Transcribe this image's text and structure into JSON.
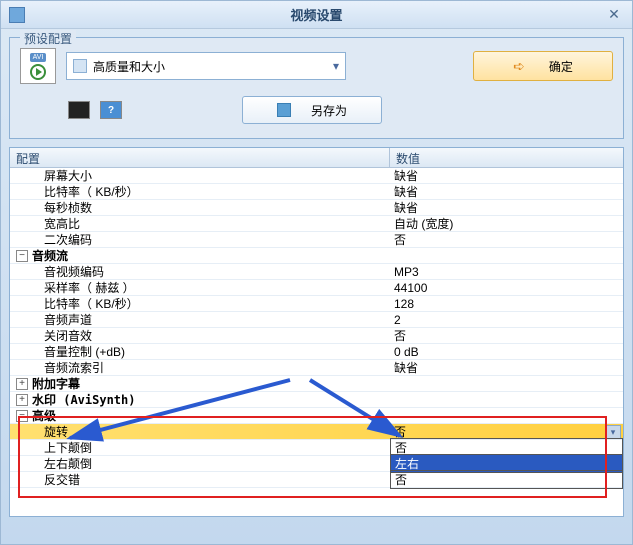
{
  "window": {
    "title": "视频设置"
  },
  "fieldset": {
    "label": "预设配置"
  },
  "preset": {
    "selected": "高质量和大小"
  },
  "buttons": {
    "ok": "确定",
    "saveas": "另存为"
  },
  "icons": {
    "avi_label": "AVI",
    "help": "?",
    "cmd": "c:\\"
  },
  "table": {
    "headers": {
      "config": "配置",
      "value": "数值"
    },
    "rows": [
      {
        "label": "屏幕大小",
        "value": "缺省",
        "indent": 1
      },
      {
        "label": "比特率（ KB/秒）",
        "value": "缺省",
        "indent": 1
      },
      {
        "label": "每秒桢数",
        "value": "缺省",
        "indent": 1
      },
      {
        "label": "宽高比",
        "value": "自动 (宽度)",
        "indent": 1
      },
      {
        "label": "二次编码",
        "value": "否",
        "indent": 1
      },
      {
        "label": "音频流",
        "value": "",
        "indent": 0,
        "toggle": "−",
        "bold": true
      },
      {
        "label": "音视频编码",
        "value": "MP3",
        "indent": 1
      },
      {
        "label": "采样率（ 赫兹 ）",
        "value": "44100",
        "indent": 1
      },
      {
        "label": "比特率（ KB/秒）",
        "value": "128",
        "indent": 1
      },
      {
        "label": "音频声道",
        "value": "2",
        "indent": 1
      },
      {
        "label": "关闭音效",
        "value": "否",
        "indent": 1
      },
      {
        "label": "音量控制 (+dB)",
        "value": "0 dB",
        "indent": 1
      },
      {
        "label": "音频流索引",
        "value": "缺省",
        "indent": 1
      },
      {
        "label": "附加字幕",
        "value": "",
        "indent": 0,
        "toggle": "+",
        "bold": true
      },
      {
        "label": "水印 (AviSynth)",
        "value": "",
        "indent": 0,
        "toggle": "+",
        "bold": true
      },
      {
        "label": "高级",
        "value": "",
        "indent": 0,
        "toggle": "−",
        "bold": true
      },
      {
        "label": "旋转",
        "value": "否",
        "indent": 1,
        "highlight": true,
        "dropdown": true
      },
      {
        "label": "上下颠倒",
        "value": "否",
        "indent": 1,
        "boxed": true
      },
      {
        "label": "左右颠倒",
        "value": "左右",
        "indent": 1,
        "selected": true,
        "boxed": true
      },
      {
        "label": "反交错",
        "value": "否",
        "indent": 1,
        "boxed": true
      }
    ]
  }
}
